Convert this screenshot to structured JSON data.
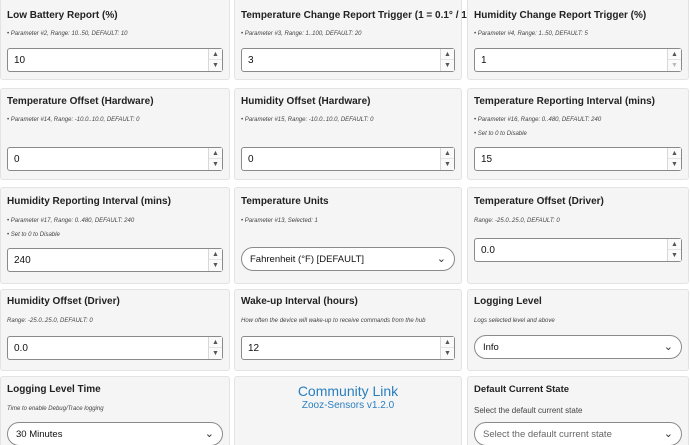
{
  "cards": [
    {
      "title": "Low Battery Report (%)",
      "desc": "• Parameter #2, Range: 10..50, DEFAULT: 10",
      "value": "10"
    },
    {
      "title": "Temperature Change Report Trigger (1 = 0.1° / 10 = 1°)",
      "desc": "• Parameter #3, Range: 1..100, DEFAULT: 20",
      "value": "3"
    },
    {
      "title": "Humidity Change Report Trigger (%)",
      "desc": "• Parameter #4, Range: 1..50, DEFAULT: 5",
      "value": "1"
    },
    {
      "title": "Temperature Offset (Hardware)",
      "desc": "• Parameter #14, Range: -10.0..10.0, DEFAULT: 0",
      "value": "0"
    },
    {
      "title": "Humidity Offset (Hardware)",
      "desc": "• Parameter #15, Range: -10.0..10.0, DEFAULT: 0",
      "value": "0"
    },
    {
      "title": "Temperature Reporting Interval (mins)",
      "desc": "• Parameter #16, Range: 0..480, DEFAULT: 240",
      "sub": "• Set to 0 to Disable",
      "value": "15"
    },
    {
      "title": "Humidity Reporting Interval (mins)",
      "desc": "• Parameter #17, Range: 0..480, DEFAULT: 240",
      "sub": "• Set to 0 to Disable",
      "value": "240"
    },
    {
      "title": "Temperature Units",
      "desc": "• Parameter #13, Selected: 1",
      "value": "Fahrenheit (°F) [DEFAULT]"
    },
    {
      "title": "Temperature Offset (Driver)",
      "desc": "Range: -25.0..25.0, DEFAULT: 0",
      "value": "0.0"
    },
    {
      "title": "Humidity Offset (Driver)",
      "desc": "Range: -25.0..25.0, DEFAULT: 0",
      "value": "0.0"
    },
    {
      "title": "Wake-up Interval (hours)",
      "desc": "How often the device will wake-up to receive commands from the hub",
      "value": "12"
    },
    {
      "title": "Logging Level",
      "desc": "Logs selected level and above",
      "value": "Info"
    },
    {
      "title": "Logging Level Time",
      "desc": "Time to enable Debug/Trace logging",
      "value": "30 Minutes"
    },
    {
      "title": "Default Current State",
      "desc": "Select the default current state",
      "placeholder": "Select the default current state"
    }
  ],
  "community": {
    "link": "Community Link",
    "version": "Zooz-Sensors v1.2.0"
  },
  "icons": {
    "up": "▲",
    "down": "▼",
    "chevron": "⌄"
  },
  "colors": {
    "accent": "#2a7fbf",
    "highlight_border": "#d0021b"
  }
}
